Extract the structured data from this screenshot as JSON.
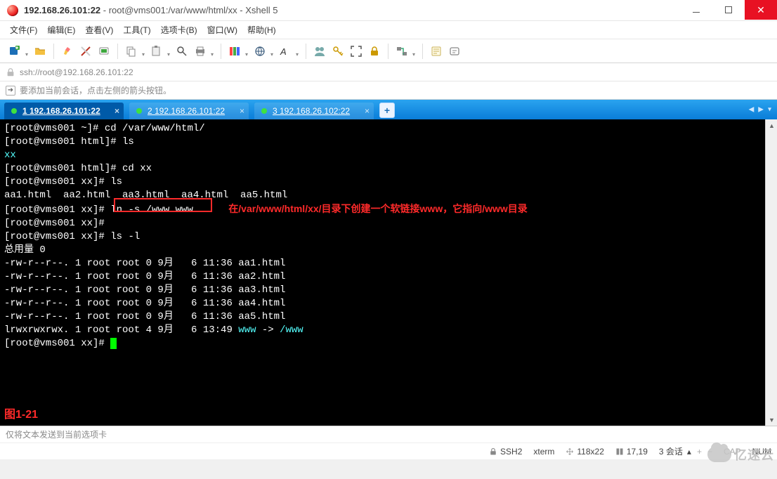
{
  "window": {
    "title_main": "192.168.26.101:22",
    "title_sub": " - root@vms001:/var/www/html/xx - Xshell 5"
  },
  "menu": {
    "items": [
      "文件(F)",
      "编辑(E)",
      "查看(V)",
      "工具(T)",
      "选项卡(B)",
      "窗口(W)",
      "帮助(H)"
    ]
  },
  "address": {
    "url": "ssh://root@192.168.26.101:22"
  },
  "hint": {
    "text": "要添加当前会话，点击左侧的箭头按钮。"
  },
  "tabs": {
    "items": [
      {
        "label": "1 192.168.26.101:22",
        "active": true
      },
      {
        "label": "2 192.168.26.101:22",
        "active": false
      },
      {
        "label": "3 192.168.26.102:22",
        "active": false
      }
    ]
  },
  "terminal": {
    "line1_prompt": "[root@vms001 ~]# ",
    "line1_cmd": "cd /var/www/html/",
    "line2_prompt": "[root@vms001 html]# ",
    "line2_cmd": "ls",
    "line3_out": "xx",
    "line4_prompt": "[root@vms001 html]# ",
    "line4_cmd": "cd xx",
    "line5_prompt": "[root@vms001 xx]# ",
    "line5_cmd": "ls",
    "line6_out": "aa1.html  aa2.html  aa3.html  aa4.html  aa5.html",
    "line7_prompt": "[root@vms001 xx]# ",
    "line7_cmd": "ln -s /www www",
    "line7_note": "在/var/www/html/xx/目录下创建一个软链接www，它指向/www目录",
    "line8_prompt": "[root@vms001 xx]# ",
    "line9_prompt": "[root@vms001 xx]# ",
    "line9_cmd": "ls -l",
    "total_line": "总用量 0",
    "rows": [
      "-rw-r--r--. 1 root root 0 9月   6 11:36 aa1.html",
      "-rw-r--r--. 1 root root 0 9月   6 11:36 aa2.html",
      "-rw-r--r--. 1 root root 0 9月   6 11:36 aa3.html",
      "-rw-r--r--. 1 root root 0 9月   6 11:36 aa4.html",
      "-rw-r--r--. 1 root root 0 9月   6 11:36 aa5.html"
    ],
    "link_row_pre": "lrwxrwxrwx. 1 root root 4 9月   6 13:49 ",
    "link_name": "www",
    "link_arrow": " -> ",
    "link_target": "/www",
    "final_prompt": "[root@vms001 xx]# ",
    "fig_label": "图1-21"
  },
  "footer": {
    "type_hint": "仅将文本发送到当前选项卡",
    "proto": "SSH2",
    "termtype": "xterm",
    "size": "118x22",
    "cursor": "17,19",
    "sessions_label": "3 会话",
    "cap": "CAP",
    "num": "NUM"
  },
  "watermark": "亿速云"
}
